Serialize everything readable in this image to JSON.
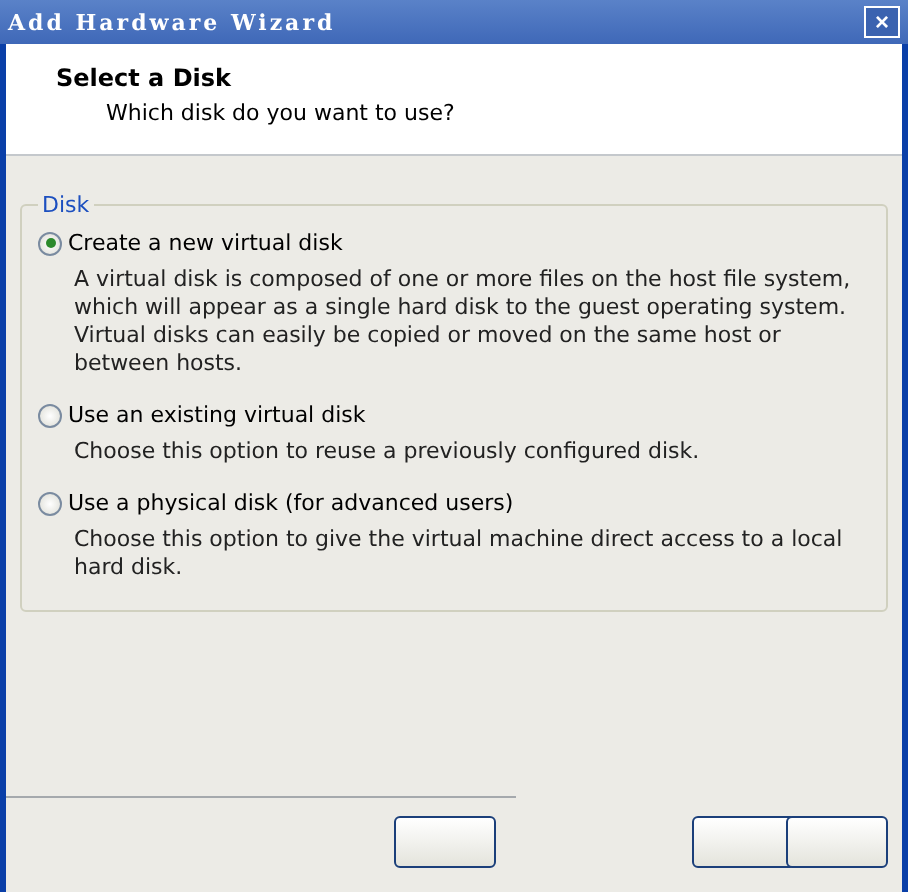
{
  "window": {
    "title": "Add Hardware Wizard",
    "close": "×"
  },
  "header": {
    "title": "Select a Disk",
    "subtitle": "Which disk do you want to use?"
  },
  "group": {
    "label": "Disk",
    "options": [
      {
        "label": "Create a new virtual disk",
        "description": "A virtual disk is composed of one or more files on the host file system, which will appear as a single hard disk to the guest operating system. Virtual disks can easily be copied or moved on the same host or between hosts.",
        "selected": true
      },
      {
        "label": "Use an existing virtual disk",
        "description": "Choose this option to reuse a previously configured disk.",
        "selected": false
      },
      {
        "label": "Use a physical disk (for advanced users)",
        "description": "Choose this option to give the virtual machine direct access to a local hard disk.",
        "selected": false
      }
    ]
  }
}
